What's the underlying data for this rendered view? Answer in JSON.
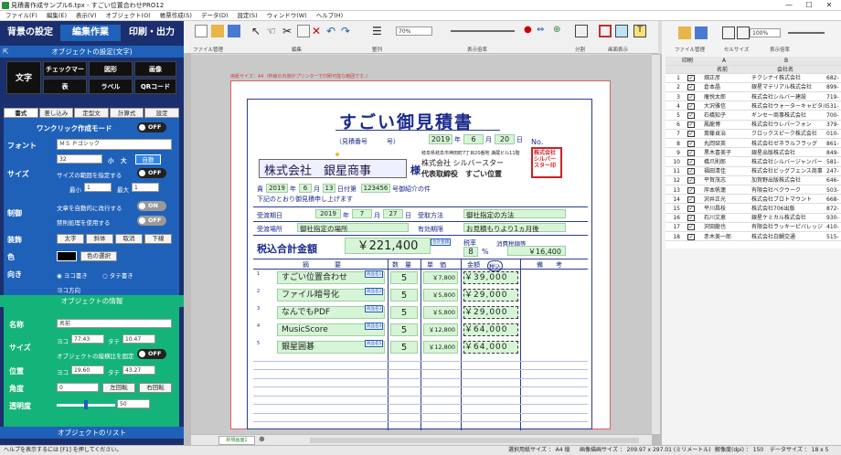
{
  "window": {
    "title": "見積書作成サンプル6.tpx - すごい位置合わせPRO12",
    "min": "—",
    "max": "☐",
    "close": "✕"
  },
  "menu": [
    "ファイル(F)",
    "編集(E)",
    "表示(V)",
    "オブジェクト(O)",
    "帳票作成(S)",
    "データ(D)",
    "設定(S)",
    "ウィンドウ(W)",
    "ヘルプ(H)"
  ],
  "left": {
    "tabs": {
      "bg": "背景の設定",
      "edit": "編集作業",
      "print": "印刷・出力"
    },
    "objset_hdr": "オブジェクトの設定(文字)",
    "types": {
      "text": "文字",
      "check": "チェックマーク",
      "shape": "図形",
      "image": "画像",
      "table": "表",
      "label": "ラベル",
      "qr": "QRコード"
    },
    "subtabs": [
      "書式",
      "差し込み",
      "定型文",
      "計算式",
      "設定"
    ],
    "oneclick": "ワンクリック作成モード",
    "off": "OFF",
    "on": "ON",
    "font_lbl": "フォント",
    "font_val": "ＭＳ Ｐゴシック",
    "size_lbl": "サイズ",
    "size_val": "32",
    "small": "小",
    "large": "大",
    "auto": "自動",
    "fit_range": "サイズの範囲を指定する",
    "min": "最小",
    "min_val": "1",
    "max": "最大",
    "max_val": "1",
    "ctrl_lbl": "制御",
    "autowrap": "文章を自動的に改行する",
    "kinsoku": "禁則処理を使用する",
    "deco_lbl": "装飾",
    "bold": "太字",
    "italic": "斜体",
    "strike": "取消",
    "underline": "下線",
    "color_lbl": "色",
    "color_pick": "色の選択",
    "dir_lbl": "向き",
    "horiz": "ヨコ書き",
    "vert": "タテ書き",
    "ydir": "ヨコ方向",
    "info_hdr": "オブジェクトの情報",
    "name_lbl": "名称",
    "name_val": "名前",
    "isize_lbl": "サイズ",
    "yoko": "ヨコ",
    "yoko_val": "77.43",
    "tate": "タテ",
    "tate_val": "10.47",
    "fixratio": "オブジェクトの縦横比を固定",
    "pos_lbl": "位置",
    "pos_x": "19.60",
    "pos_y": "43.27",
    "angle_lbl": "角度",
    "angle_val": "0",
    "rot_left": "左回転",
    "rot_right": "右回転",
    "trans_lbl": "透明度",
    "trans_val": "50",
    "list_hdr": "オブジェクトのリスト"
  },
  "toolbar": {
    "zoom": "70%",
    "groups": [
      "ファイル管理",
      "編集",
      "整列",
      "表示倍率",
      "分割",
      "画面表示"
    ]
  },
  "paper_note": "用紙サイズ：A4（枠線の内側がプリンターで印刷可能な範囲です。）",
  "doc": {
    "title": "すごい御見積書",
    "mitsu_no": "（見積番号　　　号）",
    "date_y": "2019",
    "date_y_u": "年",
    "date_m": "6",
    "date_m_u": "月",
    "date_d": "20",
    "date_d_u": "日",
    "no": "No.",
    "addr": "岐阜県岐阜市神田町7丁目20番地 満蔵ビル11階",
    "company": "株式会社 シルバースター",
    "rep": "代表取締役　すごい位置",
    "stamp": "株式会社シルバースター印",
    "client": "株式会社　銀星商事",
    "sama": "様",
    "ref_pre": "貴",
    "ref_y": "2019",
    "ref_y_u": "年",
    "ref_m": "6",
    "ref_m_u": "月",
    "ref_d": "13",
    "ref_d_u": "日付第",
    "ref_no": "123456",
    "ref_suf": "号御紹介の件",
    "intro": "下記のとおり御見積申し上げます",
    "due_lbl": "受渡期日",
    "due_y": "2019",
    "due_y_u": "年",
    "due_m": "7",
    "due_m_u": "月",
    "due_d": "27",
    "due_d_u": "日",
    "pay_lbl": "受取方法",
    "pay_val": "御社指定の方法",
    "place_lbl": "受渡場所",
    "place_val": "御社指定の場所",
    "valid_lbl": "有効期限",
    "valid_val": "お見積もりより1ヵ月後",
    "total_lbl": "税込合計金額",
    "total_val": "￥221,400",
    "total_tag": "合計金額",
    "tax_lbl": "税率",
    "tax_val": "8",
    "tax_pct": "%",
    "taxamt_lbl": "消費税額等",
    "taxamt_val": "￥16,400",
    "cols": {
      "desc": "摘　　　　要",
      "qty": "数　量",
      "price": "単　価",
      "amt": "金額",
      "incl": "税込",
      "note": "備　　考"
    },
    "items": [
      {
        "n": "1",
        "name": "すごい位置合わせ",
        "tag": "商品名1",
        "qty": "5",
        "price": "￥7,800",
        "amt": "￥39,000"
      },
      {
        "n": "2",
        "name": "ファイル暗号化",
        "tag": "商品名2",
        "qty": "5",
        "price": "￥5,800",
        "amt": "￥29,000"
      },
      {
        "n": "3",
        "name": "なんでもPDF",
        "tag": "商品名3",
        "qty": "5",
        "price": "￥5,800",
        "amt": "￥29,000"
      },
      {
        "n": "4",
        "name": "MusicScore",
        "tag": "商品名4",
        "qty": "5",
        "price": "￥12,800",
        "amt": "￥64,000"
      },
      {
        "n": "5",
        "name": "銀星囲碁",
        "tag": "商品名5",
        "qty": "5",
        "price": "￥12,800",
        "amt": "￥64,000"
      }
    ]
  },
  "bottom_tab": "新規画面1",
  "right": {
    "zoom": "100%",
    "groups": [
      "ファイル管理",
      "セルサイズ",
      "表示倍率"
    ],
    "hdr_print": "印刷",
    "colA": "A",
    "colB": "B",
    "colA_name": "名前",
    "colB_name": "会社名",
    "rows": [
      {
        "n": "1",
        "name": "畑正彦",
        "co": "チクシナイ株式会社",
        "z": "682-"
      },
      {
        "n": "2",
        "name": "倉本晶",
        "co": "銀星マテリアル株式会社",
        "z": "899-"
      },
      {
        "n": "3",
        "name": "庵悦太郎",
        "co": "株式会社シルバー建設",
        "z": "719-"
      },
      {
        "n": "4",
        "name": "大沢雅信",
        "co": "株式会社ウォーターキャピタル",
        "z": "531-"
      },
      {
        "n": "5",
        "name": "石橋知子",
        "co": "ギンセー商事株式会社",
        "z": "700-"
      },
      {
        "n": "6",
        "name": "鳳龍博",
        "co": "株式会社ウレパーフォン",
        "z": "379-"
      },
      {
        "n": "7",
        "name": "斎藤貞治",
        "co": "クロックスピーク株式会社",
        "z": "010-"
      },
      {
        "n": "8",
        "name": "丸岡栞英",
        "co": "株式会社ゼネラルフラッグ",
        "z": "861-"
      },
      {
        "n": "9",
        "name": "黒木喜美子",
        "co": "銀星出版株式会社",
        "z": "849-"
      },
      {
        "n": "10",
        "name": "橋爪則郎",
        "co": "株式会社シルバージャンパー",
        "z": "581-"
      },
      {
        "n": "11",
        "name": "福田清佳",
        "co": "株式会社ビッグフェンス商事",
        "z": "247-"
      },
      {
        "n": "12",
        "name": "平賀茂志",
        "co": "加賀野出版株式会社",
        "z": "646-"
      },
      {
        "n": "13",
        "name": "岸本帆蓮",
        "co": "有限会社ベクウーク",
        "z": "503-"
      },
      {
        "n": "14",
        "name": "沢井正光",
        "co": "株式会社ブロトマウント",
        "z": "668-"
      },
      {
        "n": "15",
        "name": "平川昌枝",
        "co": "株式会社706出版",
        "z": "872-"
      },
      {
        "n": "16",
        "name": "石川文恵",
        "co": "銀星ケミカル株式会社",
        "z": "930-"
      },
      {
        "n": "17",
        "name": "沢田龍也",
        "co": "有限会社ラッキーピバレッジ",
        "z": "410-"
      },
      {
        "n": "18",
        "name": "赤木美一郎",
        "co": "株式会社白鯛交通",
        "z": "515-"
      }
    ]
  },
  "status": {
    "left": "ヘルプを表示するには [F1] を押してください。",
    "paper": "選択用紙サイズ ： A4 縦",
    "draw": "画像描画サイズ ： 209.97 x 297.01 (ミリメートル)",
    "dpi": "解像度(dpi) ： 150",
    "data": "データサイズ ： 18 x 5"
  },
  "colors": {
    "accent": "#1f61b8",
    "green": "#14b37a",
    "navy": "#1b2f6e",
    "docline": "#2a3d8f",
    "sel": "#0a4cbf"
  }
}
